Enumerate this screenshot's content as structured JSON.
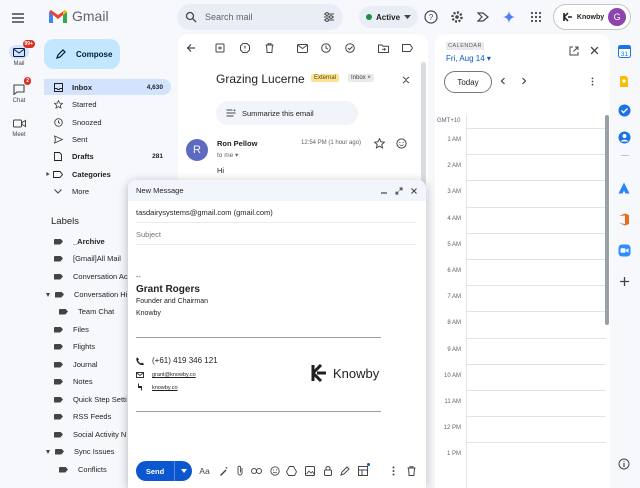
{
  "app": {
    "name": "Gmail"
  },
  "search": {
    "placeholder": "Search mail"
  },
  "status": {
    "label": "Active"
  },
  "brand": {
    "label": "Knowby",
    "avatar_initial": "G"
  },
  "rail": [
    {
      "label": "Mail",
      "badge": "99+"
    },
    {
      "label": "Chat",
      "badge": "2"
    },
    {
      "label": "Meet"
    }
  ],
  "compose_button": {
    "label": "Compose"
  },
  "nav": [
    {
      "label": "Inbox",
      "count": "4,630"
    },
    {
      "label": "Starred"
    },
    {
      "label": "Snoozed"
    },
    {
      "label": "Sent"
    },
    {
      "label": "Drafts",
      "count": "281"
    },
    {
      "label": "Categories"
    },
    {
      "label": "More"
    }
  ],
  "labels_heading": "Labels",
  "labels": [
    "_Archive",
    "[Gmail]All Mail",
    "Conversation Ac",
    "Conversation Hi",
    "Team Chat",
    "Files",
    "Flights",
    "Journal",
    "Notes",
    "Quick Step Setti",
    "RSS Feeds",
    "Social Activity N",
    "Sync Issues",
    "Conflicts"
  ],
  "email": {
    "subject": "Grazing Lucerne",
    "chip_external": "External",
    "chip_inbox": "Inbox",
    "summarize": "Summarize this email",
    "sender_initial": "R",
    "sender": "Ron Pellow",
    "to": "to me",
    "time": "12:54 PM (1 hour ago)",
    "body": "Hi"
  },
  "compose_window": {
    "title": "New Message",
    "to": "tasdairysystems@gmail.com (gmail.com)",
    "subject_placeholder": "Subject",
    "send_label": "Send",
    "signature": {
      "dash": "--",
      "name": "Grant Rogers",
      "title": "Founder and Chairman",
      "company": "Knowby",
      "phone": "(+61) 419 346 121",
      "email": "grant@knowby.co",
      "web": "knowby.co",
      "logo_text": "Knowby"
    }
  },
  "calendar": {
    "tag": "CALENDAR",
    "date": "Fri, Aug 14",
    "today_label": "Today",
    "timezone": "GMT+10",
    "hours": [
      "1 AM",
      "2 AM",
      "3 AM",
      "4 AM",
      "5 AM",
      "6 AM",
      "7 AM",
      "8 AM",
      "9 AM",
      "10 AM",
      "11 AM",
      "12 PM",
      "1 PM"
    ]
  },
  "colors": {
    "accent": "#0b57d0",
    "compose_bg": "#c2e7ff",
    "active_nav": "#d3e3fd",
    "external_chip": "#fde293",
    "status_green": "#1e8e3e",
    "avatar": "#8e44ad",
    "badge": "#d93025"
  }
}
